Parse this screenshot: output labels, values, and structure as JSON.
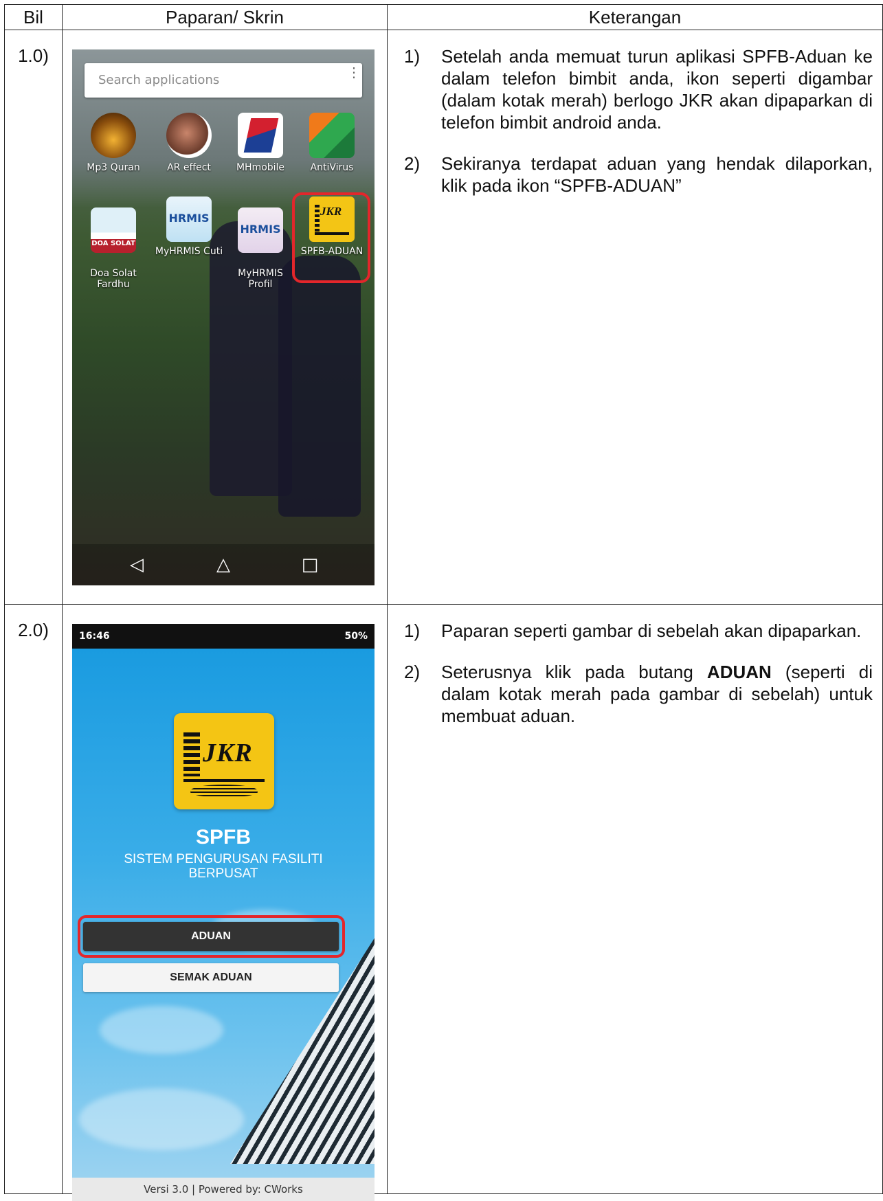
{
  "table": {
    "headers": {
      "bil": "Bil",
      "screen": "Paparan/ Skrin",
      "desc": "Keterangan"
    },
    "rows": [
      {
        "bil": "1.0)",
        "steps": [
          {
            "num": "1)",
            "text": "Setelah anda memuat turun aplikasi SPFB-Aduan ke dalam telefon bimbit anda, ikon seperti digambar (dalam kotak merah) berlogo JKR akan dipaparkan di telefon bimbit android anda."
          },
          {
            "num": "2)",
            "text": "Sekiranya terdapat aduan yang hendak dilaporkan, klik pada ikon “SPFB-ADUAN”"
          }
        ]
      },
      {
        "bil": "2.0)",
        "steps": [
          {
            "num": "1)",
            "text": "Paparan seperti gambar di sebelah akan dipaparkan."
          },
          {
            "num": "2)",
            "text_before": "Seterusnya klik pada butang ",
            "text_bold": "ADUAN",
            "text_after": " (seperti di dalam kotak merah pada gambar di sebelah) untuk membuat aduan."
          }
        ]
      }
    ]
  },
  "phone_home": {
    "search_placeholder": "Search applications",
    "apps": [
      {
        "label": "Mp3 Quran",
        "icon": "mp3-quran-icon"
      },
      {
        "label": "AR effect",
        "icon": "ar-effect-icon"
      },
      {
        "label": "MHmobile",
        "icon": "mhmobile-icon"
      },
      {
        "label": "AntiVirus",
        "icon": "antivirus-icon"
      },
      {
        "label": "Doa Solat\nFardhu",
        "icon": "doa-solat-icon",
        "icon_text": "DOA SOLAT"
      },
      {
        "label": "MyHRMIS Cuti",
        "icon": "myhrmis-cuti-icon",
        "icon_text": "HRMIS"
      },
      {
        "label": "MyHRMIS\nProfil",
        "icon": "myhrmis-profil-icon",
        "icon_text": "HRMIS"
      },
      {
        "label": "SPFB-ADUAN",
        "icon": "jkr-icon",
        "icon_text": "JKR"
      }
    ],
    "nav": {
      "back": "◁",
      "home": "△",
      "recent": "□"
    },
    "highlight_color": "#e3262b"
  },
  "phone_app": {
    "status_left": "16:46",
    "status_right": "50%",
    "logo_text": "JKR",
    "title": "SPFB",
    "subtitle": "SISTEM PENGURUSAN FASILITI BERPUSAT",
    "btn_aduan": "ADUAN",
    "btn_semak": "SEMAK ADUAN",
    "footer": "Versi 3.0 | Powered by: CWorks",
    "logo_color": "#f4c514",
    "sky_color": "#1a9be0"
  }
}
